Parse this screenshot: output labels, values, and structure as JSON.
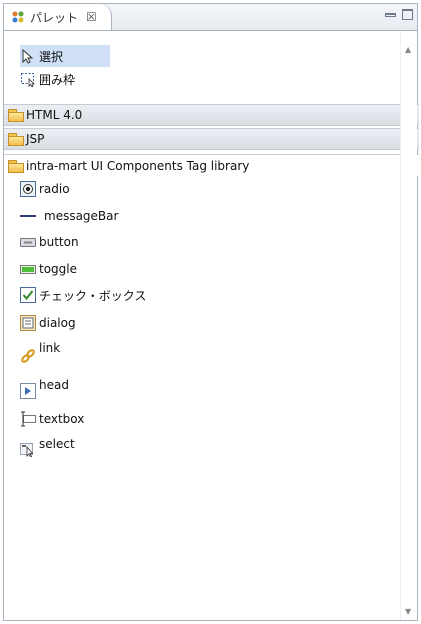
{
  "view": {
    "tab_title": "パレット",
    "tab_close": "☒"
  },
  "tools": [
    {
      "label": "選択",
      "icon": "cursor-arrow-icon",
      "selected": true
    },
    {
      "label": "囲み枠",
      "icon": "marquee-icon",
      "selected": false
    }
  ],
  "drawers": [
    {
      "label": "HTML 4.0",
      "open": false
    },
    {
      "label": "JSP",
      "open": false
    },
    {
      "label": "intra-mart UI Components Tag library",
      "open": true,
      "pin": "⇔"
    }
  ],
  "components": [
    {
      "label": "radio",
      "icon": "radio-icon"
    },
    {
      "label": "messageBar",
      "icon": "message-bar-icon"
    },
    {
      "label": "button",
      "icon": "button-icon"
    },
    {
      "label": "toggle",
      "icon": "toggle-icon"
    },
    {
      "label": "チェック・ボックス",
      "icon": "checkbox-icon"
    },
    {
      "label": "dialog",
      "icon": "dialog-icon"
    },
    {
      "label": "link",
      "icon": "link-icon"
    },
    {
      "label": "head",
      "icon": "head-icon"
    },
    {
      "label": "textbox",
      "icon": "textbox-icon"
    },
    {
      "label": "select",
      "icon": "select-icon"
    }
  ]
}
